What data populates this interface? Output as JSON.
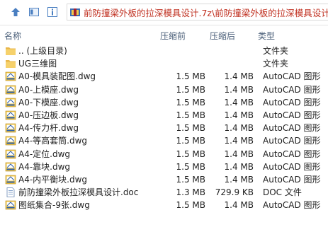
{
  "toolbar": {
    "buttons": [
      "up-arrow-icon",
      "view-icon",
      "info-icon"
    ],
    "address": "前防撞梁外板的拉深模具设计.7z\\前防撞梁外板的拉深模具设计 -"
  },
  "columns": {
    "name": "名称",
    "compressed": "压缩前",
    "original": "压缩后",
    "type": "类型"
  },
  "rows": [
    {
      "name": ".. (上级目录)",
      "compressed": "",
      "original": "",
      "type": "文件夹",
      "icon": "folder-icon"
    },
    {
      "name": "UG三维图",
      "compressed": "",
      "original": "",
      "type": "文件夹",
      "icon": "folder-icon"
    },
    {
      "name": "A0-模具装配图.dwg",
      "compressed": "1.5 MB",
      "original": "1.4 MB",
      "type": "AutoCAD 图形",
      "icon": "dwg-file-icon"
    },
    {
      "name": "A0-上模座.dwg",
      "compressed": "1.5 MB",
      "original": "1.4 MB",
      "type": "AutoCAD 图形",
      "icon": "dwg-file-icon"
    },
    {
      "name": "A0-下模座.dwg",
      "compressed": "1.5 MB",
      "original": "1.4 MB",
      "type": "AutoCAD 图形",
      "icon": "dwg-file-icon"
    },
    {
      "name": "A0-压边板.dwg",
      "compressed": "1.5 MB",
      "original": "1.4 MB",
      "type": "AutoCAD 图形",
      "icon": "dwg-file-icon"
    },
    {
      "name": "A4-传力杆.dwg",
      "compressed": "1.5 MB",
      "original": "1.4 MB",
      "type": "AutoCAD 图形",
      "icon": "dwg-file-icon"
    },
    {
      "name": "A4-等高套筒.dwg",
      "compressed": "1.5 MB",
      "original": "1.4 MB",
      "type": "AutoCAD 图形",
      "icon": "dwg-file-icon"
    },
    {
      "name": "A4-定位.dwg",
      "compressed": "1.5 MB",
      "original": "1.4 MB",
      "type": "AutoCAD 图形",
      "icon": "dwg-file-icon"
    },
    {
      "name": "A4-靠块.dwg",
      "compressed": "1.5 MB",
      "original": "1.4 MB",
      "type": "AutoCAD 图形",
      "icon": "dwg-file-icon"
    },
    {
      "name": "A4-内平衡块.dwg",
      "compressed": "1.5 MB",
      "original": "1.4 MB",
      "type": "AutoCAD 图形",
      "icon": "dwg-file-icon"
    },
    {
      "name": "前防撞梁外板拉深模具设计.doc",
      "compressed": "1.3 MB",
      "original": "729.9 KB",
      "type": "DOC 文件",
      "icon": "doc-file-icon"
    },
    {
      "name": "图纸集合-9张.dwg",
      "compressed": "1.5 MB",
      "original": "1.4 MB",
      "type": "AutoCAD 图形",
      "icon": "dwg-file-icon"
    }
  ]
}
